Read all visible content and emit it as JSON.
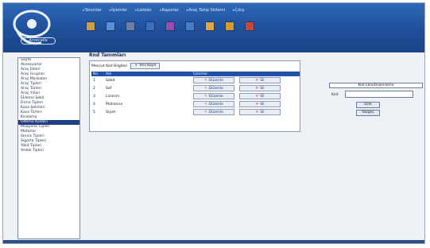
{
  "colors": {
    "header": "#1f4f99",
    "selected": "#1f3f86",
    "table_header": "#1f52a8",
    "delete_x": "#c21a1a"
  },
  "header": {
    "logo_text": "Arvecaila",
    "menu": [
      "Tanımlar",
      "İşlemler",
      "Listeler",
      "Raporlar",
      "Araç Takip Sistemi",
      "Çıkış"
    ],
    "toolbar_icons": [
      {
        "name": "car-icon",
        "color": "#c8a04a"
      },
      {
        "name": "book-icon",
        "color": "#5a8fd8"
      },
      {
        "name": "list-icon",
        "color": "#6b7fa8"
      },
      {
        "name": "monitor-icon",
        "color": "#3e6fc2"
      },
      {
        "name": "table-icon",
        "color": "#9b4ab0"
      },
      {
        "name": "grid-icon",
        "color": "#4a7ec4"
      },
      {
        "name": "note-icon",
        "color": "#e0a840"
      },
      {
        "name": "folder-icon",
        "color": "#d49a2c"
      },
      {
        "name": "chart-icon",
        "color": "#c4483a"
      }
    ]
  },
  "sidebar": {
    "items": [
      "Sayfa",
      "Aksesuarlar",
      "Araç Ekleri",
      "Araç Grupları",
      "Araç Markaları",
      "Araç Tipleri",
      "Araç Türleri",
      "Araç Yılları",
      "Ekleme Şekli",
      "Firma Tipleri",
      "Kasa Şekilleri",
      "Kasa Türleri",
      "Kiralama",
      "Ödeme Kodları",
      "Muayene Tipleri",
      "Motorlar",
      "Servis Tipleri",
      "Sigorta Tipleri",
      "Yakıt Tipleri",
      "Yedek Tipleri"
    ],
    "selected_index": 13
  },
  "main": {
    "title": "Rnd Tanımları",
    "bar_label": "Mevcut Kod Bilgileri",
    "add_button": "Yeni Kayıt",
    "columns": [
      "No",
      "Adı",
      "İşlemler"
    ],
    "rows": [
      {
        "id": "1",
        "name": "Sabit"
      },
      {
        "id": "2",
        "name": "Saf"
      },
      {
        "id": "3",
        "name": "Lisanslı"
      },
      {
        "id": "4",
        "name": "Mahanna"
      },
      {
        "id": "5",
        "name": "Siyah"
      }
    ],
    "edit_label": "Düzenle",
    "delete_label": "Sil"
  },
  "form": {
    "header": "Kod Ekle/Düzenleme",
    "field_label": "Kod",
    "field_value": "",
    "save_label": "Ekle",
    "cancel_label": "Vazgeç"
  }
}
